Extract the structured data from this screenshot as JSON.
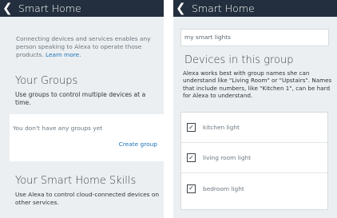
{
  "left_screen": {
    "title": "Smart Home",
    "intro_text": "Connecting devices and services enables any person speaking to Alexa to operate those products.",
    "learn_more_link": "Learn more.",
    "groups_heading": "Your Groups",
    "groups_description": "Use groups to control multiple devices at a time.",
    "empty_groups_message": "You don't have any groups yet",
    "create_group_link": "Create group",
    "skills_heading": "Your Smart Home Skills",
    "skills_description": "Use Alexa to control cloud-connected devices on other services."
  },
  "right_screen": {
    "title": "Smart Home",
    "group_name_value": "my smart lights",
    "devices_heading": "Devices in this group",
    "devices_description": "Alexa works best with group names she can understand like \"Living Room\" or \"Upstairs\". Names that include numbers, like \"Kitchen 1\", can be hard for Alexa to understand.",
    "devices": [
      {
        "label": "kitchen light",
        "checked": true
      },
      {
        "label": "living room light",
        "checked": true
      },
      {
        "label": "bedroom light",
        "checked": true
      }
    ]
  },
  "icons": {
    "back": "chevron-left-icon",
    "checkbox": "checkmark-icon"
  },
  "colors": {
    "header_bg": "#232f3e",
    "background": "#eceff1",
    "link": "#1a73b8"
  }
}
